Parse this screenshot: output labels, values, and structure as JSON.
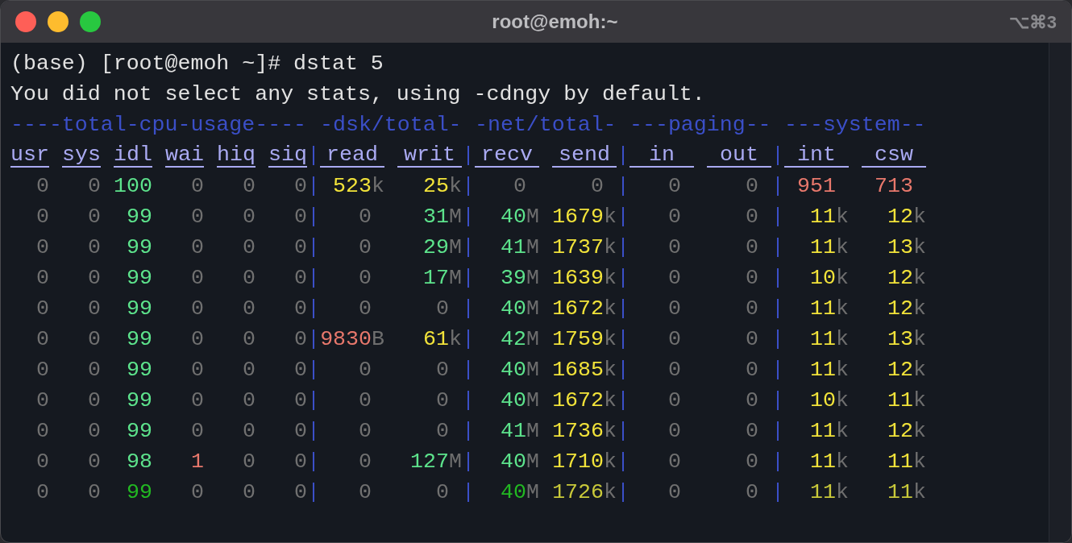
{
  "window": {
    "title": "root@emoh:~",
    "shortcut": "⌥⌘3"
  },
  "lines": [
    "(base) [root@emoh ~]# dstat 5",
    "You did not select any stats, using -cdngy by default."
  ],
  "groups": [
    {
      "title": "----total-cpu-usage----",
      "kind": "narrow",
      "columns": [
        "usr",
        "sys",
        "idl",
        "wai",
        "hiq",
        "siq"
      ]
    },
    {
      "title": "-dsk/total-",
      "kind": "wide",
      "columns": [
        "read",
        "writ"
      ]
    },
    {
      "title": "-net/total-",
      "kind": "wide",
      "columns": [
        "recv",
        "send"
      ]
    },
    {
      "title": "---paging--",
      "kind": "wide",
      "columns": [
        "in",
        "out"
      ]
    },
    {
      "title": "---system--",
      "kind": "wide",
      "columns": [
        "int",
        "csw"
      ]
    }
  ],
  "rows": [
    [
      {
        "text": "0",
        "color": "#707070"
      },
      {
        "text": "0",
        "color": "#707070"
      },
      {
        "text": "100",
        "color": "#5de38c"
      },
      {
        "text": "0",
        "color": "#707070"
      },
      {
        "text": "0",
        "color": "#707070"
      },
      {
        "text": "0",
        "color": "#707070"
      },
      {
        "text": "523",
        "unit": "k",
        "color": "#f2e33a"
      },
      {
        "text": "25",
        "unit": "k",
        "color": "#f2e33a"
      },
      {
        "text": "0",
        "color": "#707070"
      },
      {
        "text": "0",
        "color": "#707070"
      },
      {
        "text": "0",
        "color": "#707070"
      },
      {
        "text": "0",
        "color": "#707070"
      },
      {
        "text": "951",
        "color": "#e8786c"
      },
      {
        "text": "713",
        "color": "#e8786c"
      }
    ],
    [
      {
        "text": "0",
        "color": "#707070"
      },
      {
        "text": "0",
        "color": "#707070"
      },
      {
        "text": "99",
        "color": "#5de38c"
      },
      {
        "text": "0",
        "color": "#707070"
      },
      {
        "text": "0",
        "color": "#707070"
      },
      {
        "text": "0",
        "color": "#707070"
      },
      {
        "text": "0",
        "color": "#707070"
      },
      {
        "text": "31",
        "unit": "M",
        "color": "#5de38c"
      },
      {
        "text": "40",
        "unit": "M",
        "color": "#5de38c"
      },
      {
        "text": "1679",
        "unit": "k",
        "color": "#f2e33a"
      },
      {
        "text": "0",
        "color": "#707070"
      },
      {
        "text": "0",
        "color": "#707070"
      },
      {
        "text": "11",
        "unit": "k",
        "color": "#f2e33a"
      },
      {
        "text": "12",
        "unit": "k",
        "color": "#f2e33a"
      }
    ],
    [
      {
        "text": "0",
        "color": "#707070"
      },
      {
        "text": "0",
        "color": "#707070"
      },
      {
        "text": "99",
        "color": "#5de38c"
      },
      {
        "text": "0",
        "color": "#707070"
      },
      {
        "text": "0",
        "color": "#707070"
      },
      {
        "text": "0",
        "color": "#707070"
      },
      {
        "text": "0",
        "color": "#707070"
      },
      {
        "text": "29",
        "unit": "M",
        "color": "#5de38c"
      },
      {
        "text": "41",
        "unit": "M",
        "color": "#5de38c"
      },
      {
        "text": "1737",
        "unit": "k",
        "color": "#f2e33a"
      },
      {
        "text": "0",
        "color": "#707070"
      },
      {
        "text": "0",
        "color": "#707070"
      },
      {
        "text": "11",
        "unit": "k",
        "color": "#f2e33a"
      },
      {
        "text": "13",
        "unit": "k",
        "color": "#f2e33a"
      }
    ],
    [
      {
        "text": "0",
        "color": "#707070"
      },
      {
        "text": "0",
        "color": "#707070"
      },
      {
        "text": "99",
        "color": "#5de38c"
      },
      {
        "text": "0",
        "color": "#707070"
      },
      {
        "text": "0",
        "color": "#707070"
      },
      {
        "text": "0",
        "color": "#707070"
      },
      {
        "text": "0",
        "color": "#707070"
      },
      {
        "text": "17",
        "unit": "M",
        "color": "#5de38c"
      },
      {
        "text": "39",
        "unit": "M",
        "color": "#5de38c"
      },
      {
        "text": "1639",
        "unit": "k",
        "color": "#f2e33a"
      },
      {
        "text": "0",
        "color": "#707070"
      },
      {
        "text": "0",
        "color": "#707070"
      },
      {
        "text": "10",
        "unit": "k",
        "color": "#f2e33a"
      },
      {
        "text": "12",
        "unit": "k",
        "color": "#f2e33a"
      }
    ],
    [
      {
        "text": "0",
        "color": "#707070"
      },
      {
        "text": "0",
        "color": "#707070"
      },
      {
        "text": "99",
        "color": "#5de38c"
      },
      {
        "text": "0",
        "color": "#707070"
      },
      {
        "text": "0",
        "color": "#707070"
      },
      {
        "text": "0",
        "color": "#707070"
      },
      {
        "text": "0",
        "color": "#707070"
      },
      {
        "text": "0",
        "color": "#707070"
      },
      {
        "text": "40",
        "unit": "M",
        "color": "#5de38c"
      },
      {
        "text": "1672",
        "unit": "k",
        "color": "#f2e33a"
      },
      {
        "text": "0",
        "color": "#707070"
      },
      {
        "text": "0",
        "color": "#707070"
      },
      {
        "text": "11",
        "unit": "k",
        "color": "#f2e33a"
      },
      {
        "text": "12",
        "unit": "k",
        "color": "#f2e33a"
      }
    ],
    [
      {
        "text": "0",
        "color": "#707070"
      },
      {
        "text": "0",
        "color": "#707070"
      },
      {
        "text": "99",
        "color": "#5de38c"
      },
      {
        "text": "0",
        "color": "#707070"
      },
      {
        "text": "0",
        "color": "#707070"
      },
      {
        "text": "0",
        "color": "#707070"
      },
      {
        "text": "9830",
        "unit": "B",
        "color": "#e8786c"
      },
      {
        "text": "61",
        "unit": "k",
        "color": "#f2e33a"
      },
      {
        "text": "42",
        "unit": "M",
        "color": "#5de38c"
      },
      {
        "text": "1759",
        "unit": "k",
        "color": "#f2e33a"
      },
      {
        "text": "0",
        "color": "#707070"
      },
      {
        "text": "0",
        "color": "#707070"
      },
      {
        "text": "11",
        "unit": "k",
        "color": "#f2e33a"
      },
      {
        "text": "13",
        "unit": "k",
        "color": "#f2e33a"
      }
    ],
    [
      {
        "text": "0",
        "color": "#707070"
      },
      {
        "text": "0",
        "color": "#707070"
      },
      {
        "text": "99",
        "color": "#5de38c"
      },
      {
        "text": "0",
        "color": "#707070"
      },
      {
        "text": "0",
        "color": "#707070"
      },
      {
        "text": "0",
        "color": "#707070"
      },
      {
        "text": "0",
        "color": "#707070"
      },
      {
        "text": "0",
        "color": "#707070"
      },
      {
        "text": "40",
        "unit": "M",
        "color": "#5de38c"
      },
      {
        "text": "1685",
        "unit": "k",
        "color": "#f2e33a"
      },
      {
        "text": "0",
        "color": "#707070"
      },
      {
        "text": "0",
        "color": "#707070"
      },
      {
        "text": "11",
        "unit": "k",
        "color": "#f2e33a"
      },
      {
        "text": "12",
        "unit": "k",
        "color": "#f2e33a"
      }
    ],
    [
      {
        "text": "0",
        "color": "#707070"
      },
      {
        "text": "0",
        "color": "#707070"
      },
      {
        "text": "99",
        "color": "#5de38c"
      },
      {
        "text": "0",
        "color": "#707070"
      },
      {
        "text": "0",
        "color": "#707070"
      },
      {
        "text": "0",
        "color": "#707070"
      },
      {
        "text": "0",
        "color": "#707070"
      },
      {
        "text": "0",
        "color": "#707070"
      },
      {
        "text": "40",
        "unit": "M",
        "color": "#5de38c"
      },
      {
        "text": "1672",
        "unit": "k",
        "color": "#f2e33a"
      },
      {
        "text": "0",
        "color": "#707070"
      },
      {
        "text": "0",
        "color": "#707070"
      },
      {
        "text": "10",
        "unit": "k",
        "color": "#f2e33a"
      },
      {
        "text": "11",
        "unit": "k",
        "color": "#f2e33a"
      }
    ],
    [
      {
        "text": "0",
        "color": "#707070"
      },
      {
        "text": "0",
        "color": "#707070"
      },
      {
        "text": "99",
        "color": "#5de38c"
      },
      {
        "text": "0",
        "color": "#707070"
      },
      {
        "text": "0",
        "color": "#707070"
      },
      {
        "text": "0",
        "color": "#707070"
      },
      {
        "text": "0",
        "color": "#707070"
      },
      {
        "text": "0",
        "color": "#707070"
      },
      {
        "text": "41",
        "unit": "M",
        "color": "#5de38c"
      },
      {
        "text": "1736",
        "unit": "k",
        "color": "#f2e33a"
      },
      {
        "text": "0",
        "color": "#707070"
      },
      {
        "text": "0",
        "color": "#707070"
      },
      {
        "text": "11",
        "unit": "k",
        "color": "#f2e33a"
      },
      {
        "text": "12",
        "unit": "k",
        "color": "#f2e33a"
      }
    ],
    [
      {
        "text": "0",
        "color": "#707070"
      },
      {
        "text": "0",
        "color": "#707070"
      },
      {
        "text": "98",
        "color": "#5de38c"
      },
      {
        "text": "1",
        "color": "#e8786c"
      },
      {
        "text": "0",
        "color": "#707070"
      },
      {
        "text": "0",
        "color": "#707070"
      },
      {
        "text": "0",
        "color": "#707070"
      },
      {
        "text": "127",
        "unit": "M",
        "color": "#5de38c"
      },
      {
        "text": "40",
        "unit": "M",
        "color": "#5de38c"
      },
      {
        "text": "1710",
        "unit": "k",
        "color": "#f2e33a"
      },
      {
        "text": "0",
        "color": "#707070"
      },
      {
        "text": "0",
        "color": "#707070"
      },
      {
        "text": "11",
        "unit": "k",
        "color": "#f2e33a"
      },
      {
        "text": "11",
        "unit": "k",
        "color": "#f2e33a"
      }
    ],
    [
      {
        "text": "0",
        "color": "#707070"
      },
      {
        "text": "0",
        "color": "#707070"
      },
      {
        "text": "99",
        "color": "#22b822"
      },
      {
        "text": "0",
        "color": "#707070"
      },
      {
        "text": "0",
        "color": "#707070"
      },
      {
        "text": "0",
        "color": "#707070"
      },
      {
        "text": "0",
        "color": "#707070"
      },
      {
        "text": "0",
        "color": "#707070"
      },
      {
        "text": "40",
        "unit": "M",
        "color": "#22b822"
      },
      {
        "text": "1726",
        "unit": "k",
        "color": "#c9c93a"
      },
      {
        "text": "0",
        "color": "#707070"
      },
      {
        "text": "0",
        "color": "#707070"
      },
      {
        "text": "11",
        "unit": "k",
        "color": "#c9c93a"
      },
      {
        "text": "11",
        "unit": "k",
        "color": "#c9c93a"
      }
    ]
  ]
}
